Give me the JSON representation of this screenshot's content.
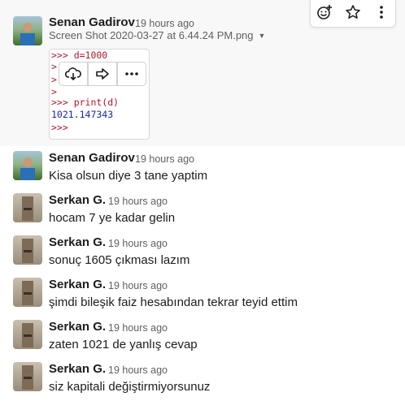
{
  "messages": [
    {
      "author": "Senan Gadirov",
      "time": "19 hours ago",
      "file": "Screen Shot 2020-03-27 at 6.44.24 PM.png",
      "code_lines": [
        ">>> d=1000",
        ">",
        ">",
        ">",
        ">>> print(d)",
        "1021.147343",
        ">>>"
      ]
    },
    {
      "author": "Senan Gadirov",
      "time": "19 hours ago",
      "text": "Kisa olsun diye 3 tane yaptim"
    },
    {
      "author": "Serkan G.",
      "time": "19 hours ago",
      "text": "hocam 7 ye kadar gelin"
    },
    {
      "author": "Serkan G.",
      "time": "19 hours ago",
      "text": "sonuç 1605 çıkması lazım"
    },
    {
      "author": "Serkan G.",
      "time": "19 hours ago",
      "text": "şimdi bileşik faiz hesabından tekrar teyid ettim"
    },
    {
      "author": "Serkan G.",
      "time": "19 hours ago",
      "text": "zaten 1021 de yanlış cevap"
    },
    {
      "author": "Serkan G.",
      "time": "19 hours ago",
      "text": "siz kapitali değiştirmiyorsunuz"
    }
  ],
  "icons": {
    "reaction": "add-reaction-icon",
    "bookmark": "star-icon",
    "more": "more-vertical-icon",
    "download": "cloud-download-icon",
    "share": "share-arrow-icon",
    "image_more": "more-horizontal-icon"
  }
}
